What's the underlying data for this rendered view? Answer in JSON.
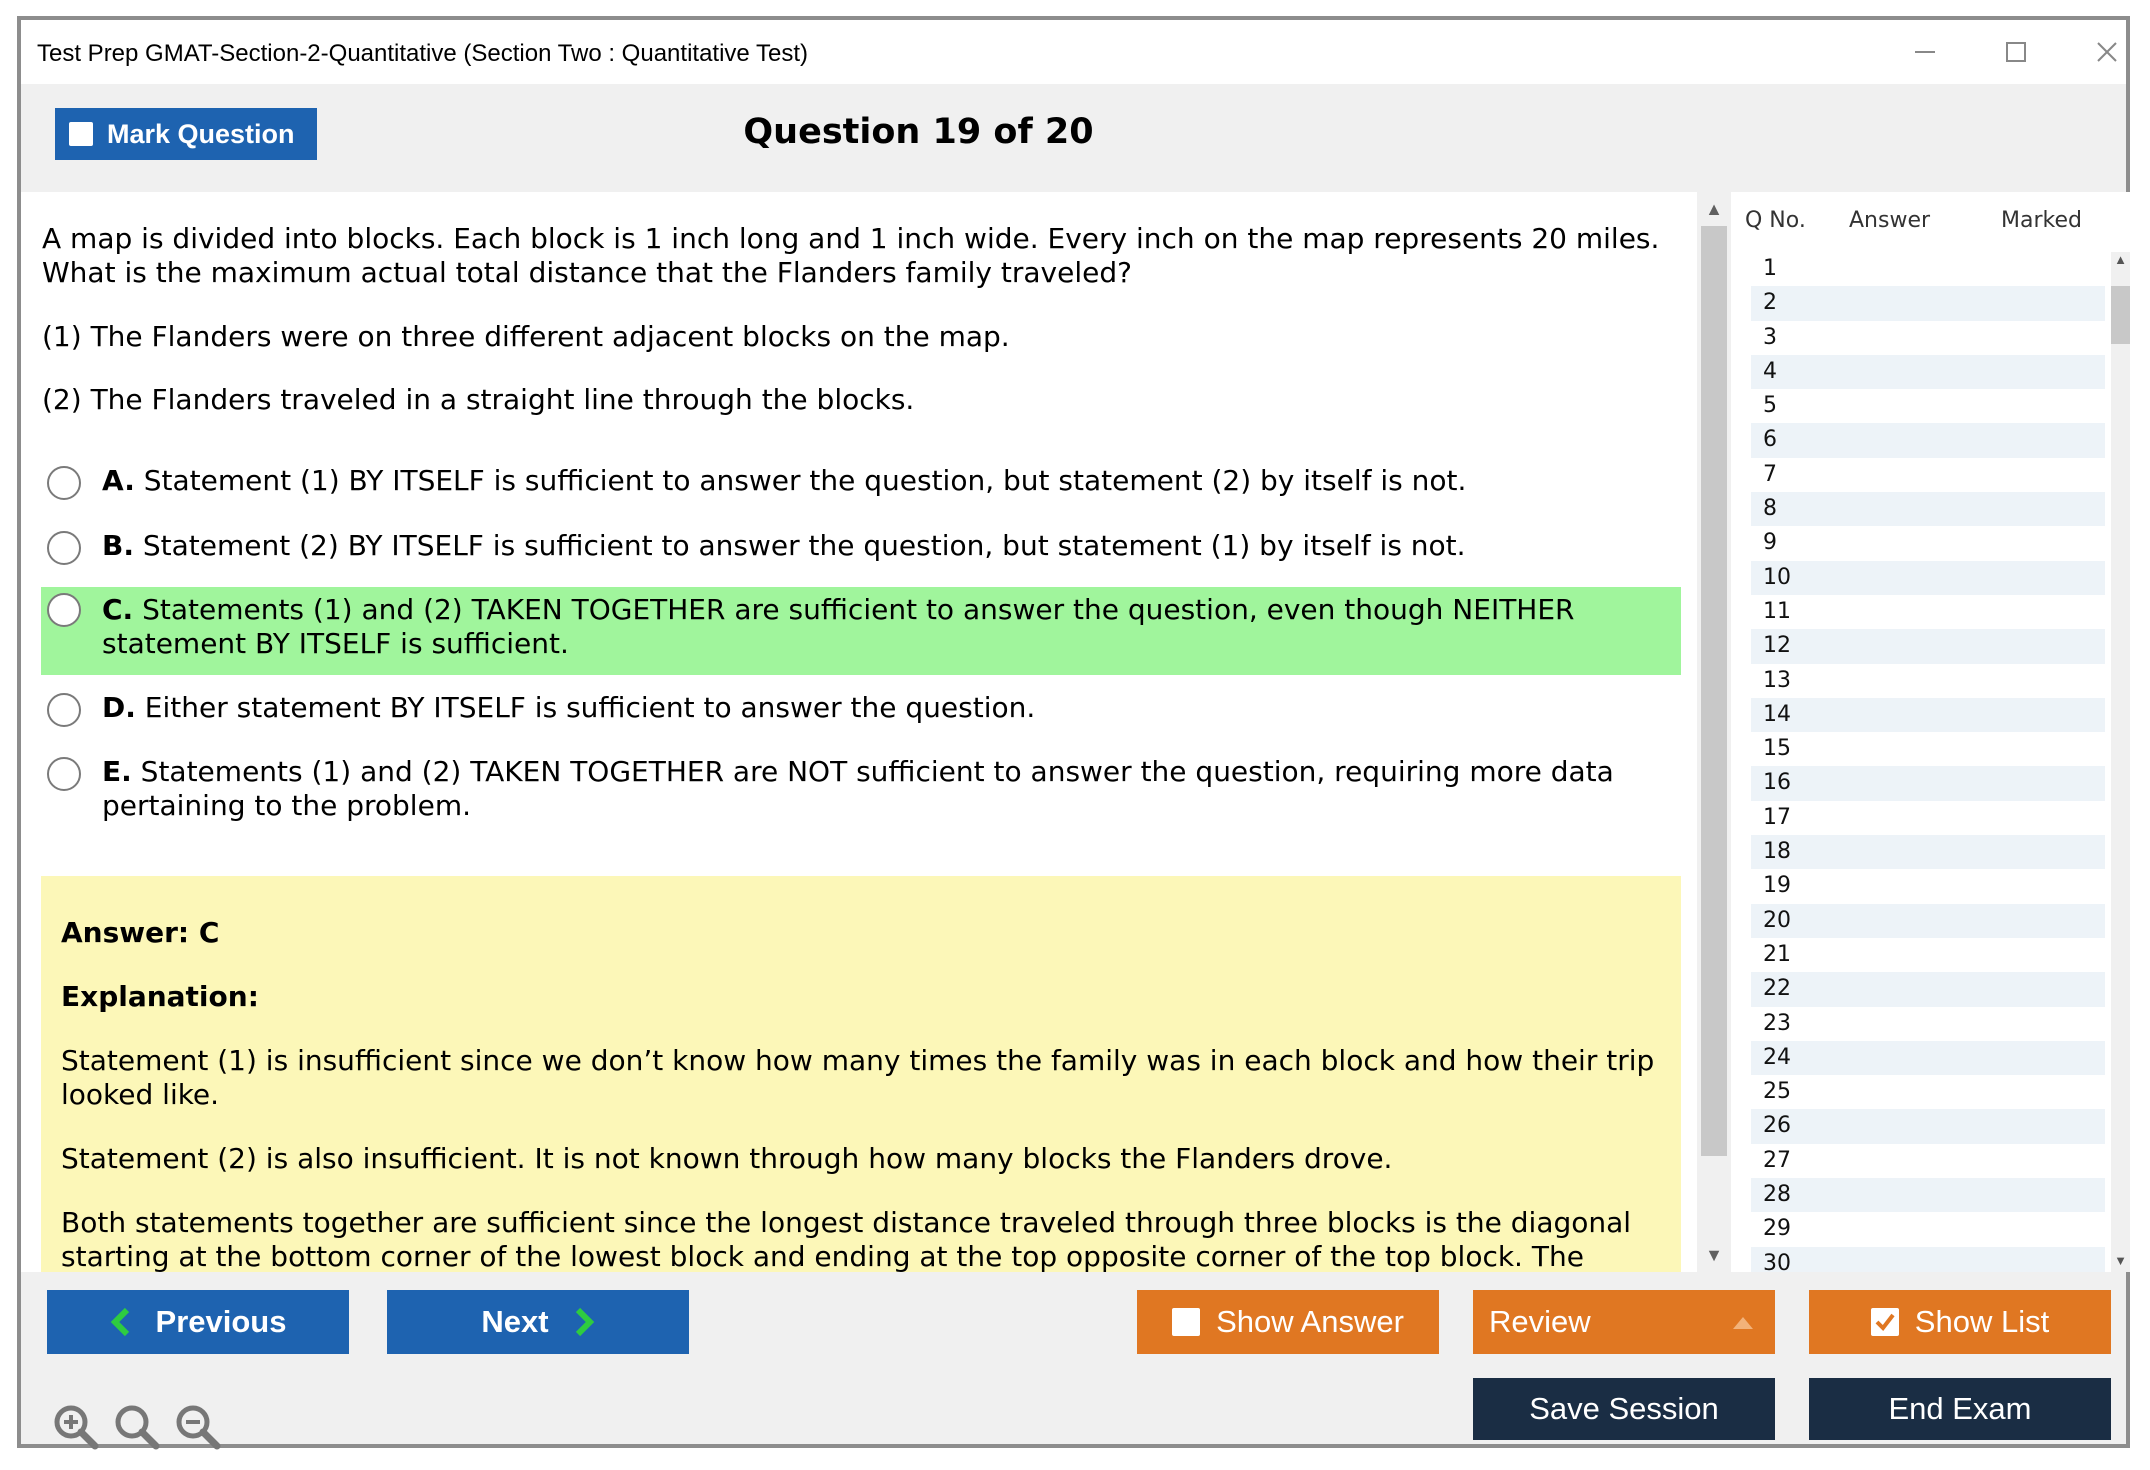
{
  "window": {
    "title": "Test Prep GMAT-Section-2-Quantitative (Section Two : Quantitative Test)"
  },
  "header": {
    "mark_label": "Mark Question",
    "question_title": "Question 19 of 20"
  },
  "question": {
    "text": "A map is divided into blocks. Each block is 1 inch long and 1 inch wide. Every inch on the map represents 20 miles. What is the maximum actual total distance that the Flanders family traveled?",
    "statement1": "(1) The Flanders were on three different adjacent blocks on the map.",
    "statement2": "(2) The Flanders traveled in a straight line through the blocks.",
    "options": [
      {
        "letter": "A.",
        "text": "Statement (1) BY ITSELF is sufficient to answer the question, but statement (2) by itself is not."
      },
      {
        "letter": "B.",
        "text": "Statement (2) BY ITSELF is sufficient to answer the question, but statement (1) by itself is not."
      },
      {
        "letter": "C.",
        "text": "Statements (1) and (2) TAKEN TOGETHER are sufficient to answer the question, even though NEITHER statement BY ITSELF is sufficient."
      },
      {
        "letter": "D.",
        "text": "Either statement BY ITSELF is sufficient to answer the question."
      },
      {
        "letter": "E.",
        "text": "Statements (1) and (2) TAKEN TOGETHER are NOT sufficient to answer the question, requiring more data pertaining to the problem."
      }
    ]
  },
  "answer": {
    "answer_label": "Answer: C",
    "explanation_label": "Explanation:",
    "paragraphs": [
      "Statement (1) is insufficient since we don’t know how many times the family was in each block and how their trip looked like.",
      "Statement (2) is also insufficient. It is not known through how many blocks the Flanders drove.",
      "Both statements together are sufficient since the longest distance traveled through three blocks is the diagonal starting at the bottom corner of the lowest block and ending at the top opposite corner of the top block. The length of this line can be"
    ]
  },
  "qlist": {
    "col_qno": "Q No.",
    "col_answer": "Answer",
    "col_marked": "Marked",
    "rows": [
      "1",
      "2",
      "3",
      "4",
      "5",
      "6",
      "7",
      "8",
      "9",
      "10",
      "11",
      "12",
      "13",
      "14",
      "15",
      "16",
      "17",
      "18",
      "19",
      "20",
      "21",
      "22",
      "23",
      "24",
      "25",
      "26",
      "27",
      "28",
      "29",
      "30"
    ]
  },
  "footer": {
    "previous": "Previous",
    "next": "Next",
    "show_answer": "Show Answer",
    "review": "Review",
    "show_list": "Show List",
    "save_session": "Save Session",
    "end_exam": "End Exam"
  },
  "colors": {
    "blue": "#1e63b0",
    "orange": "#e07722",
    "navy": "#1a2d44",
    "correct": "#a0f59c",
    "explanation_bg": "#fcf7b8",
    "arrow_green": "#2ecc40"
  },
  "icons": [
    "minimize-icon",
    "maximize-icon",
    "close-icon",
    "chevron-left-icon",
    "chevron-right-icon",
    "caret-up-icon",
    "check-icon",
    "zoom-in-icon",
    "zoom-reset-icon",
    "zoom-out-icon"
  ]
}
